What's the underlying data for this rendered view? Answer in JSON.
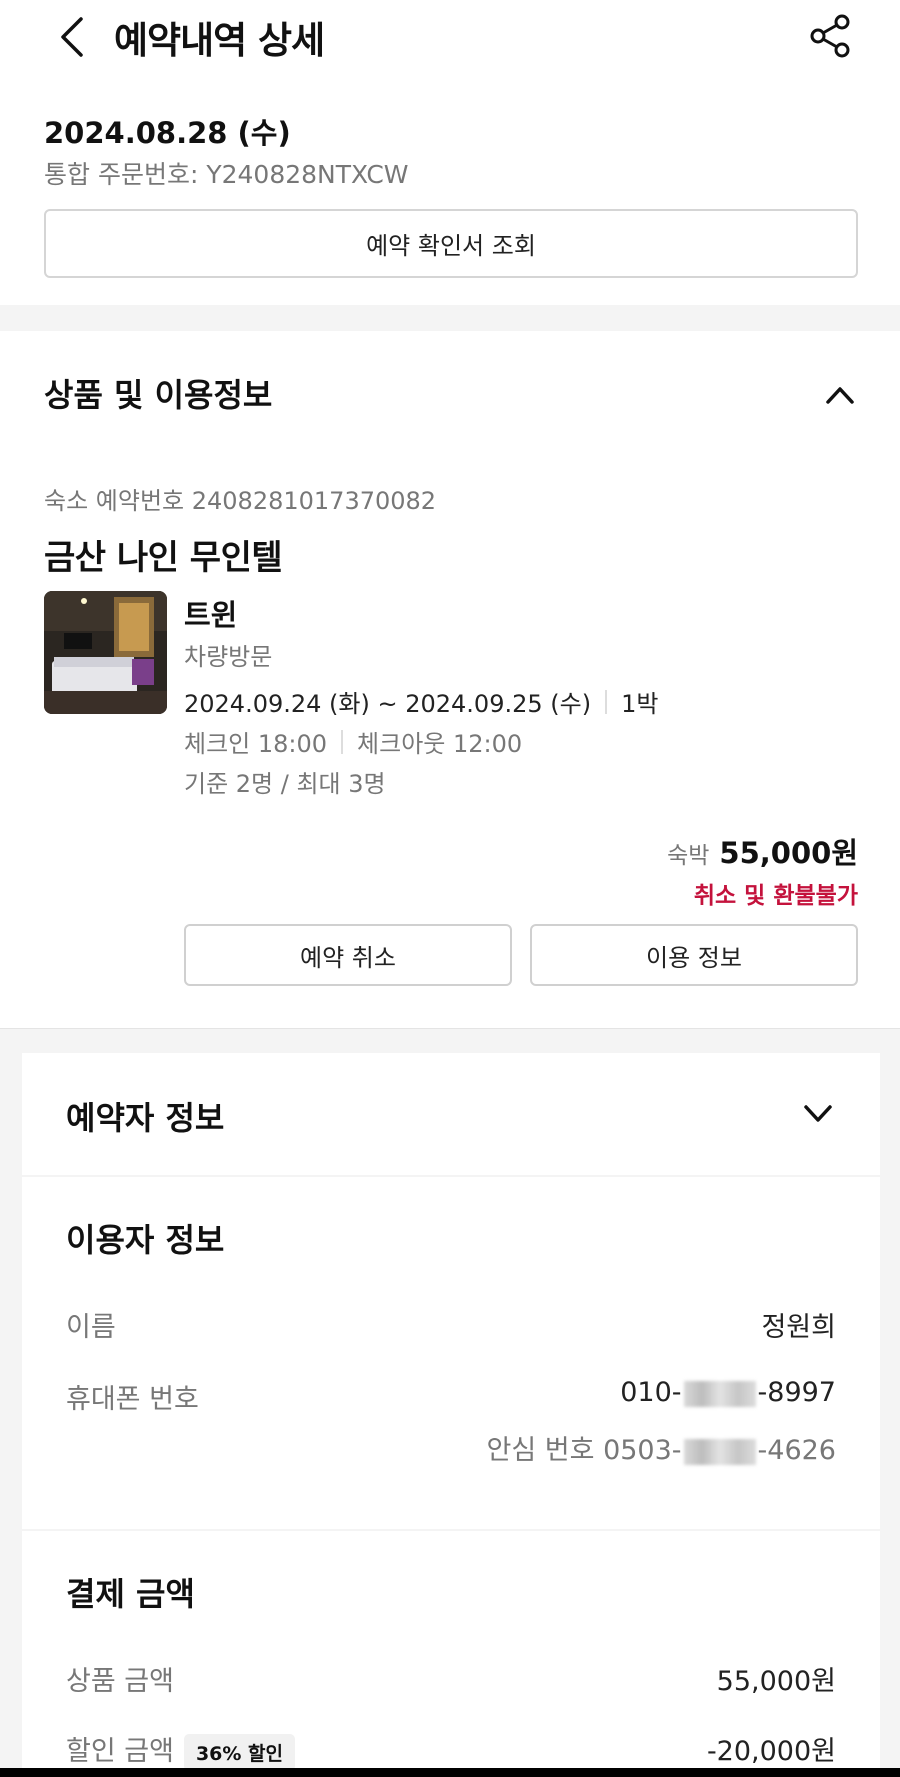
{
  "header": {
    "title": "예약내역 상세",
    "back_icon": "chevron-left-icon",
    "share_icon": "share-icon"
  },
  "order": {
    "date": "2024.08.28 (수)",
    "number_label": "통합 주문번호: ",
    "number": "Y240828NTXCW",
    "confirm_button": "예약 확인서 조회"
  },
  "product_section": {
    "title": "상품 및 이용정보",
    "toggle_icon": "chevron-up-icon",
    "reservation_label": "숙소 예약번호",
    "reservation_number": "2408281017370082",
    "hotel_name": "금산 나인 무인텔",
    "room": {
      "name": "트윈",
      "option": "차량방문",
      "dates": "2024.09.24 (화) ~ 2024.09.25 (수)",
      "nights": "1박",
      "checkin": "체크인 18:00",
      "checkout": "체크아웃 12:00",
      "occupancy": "기준 2명 / 최대 3명"
    },
    "price_label": "숙박",
    "price": "55,000원",
    "refund_notice": "취소 및 환불불가",
    "cancel_button": "예약 취소",
    "info_button": "이용 정보"
  },
  "booker_section": {
    "title": "예약자 정보",
    "toggle_icon": "chevron-down-icon"
  },
  "user_section": {
    "title": "이용자 정보",
    "name_label": "이름",
    "name_value": "정원희",
    "phone_label": "휴대폰 번호",
    "phone_prefix": "010-",
    "phone_suffix": "-8997",
    "safe_label": "안심 번호",
    "safe_prefix": "0503-",
    "safe_suffix": "-4626"
  },
  "payment_section": {
    "title": "결제 금액",
    "product_label": "상품 금액",
    "product_value": "55,000원",
    "discount_label": "할인 금액",
    "discount_badge": "36% 할인",
    "discount_value": "-20,000원"
  },
  "colors": {
    "accent_red": "#c4123c",
    "border": "#d5d5d5",
    "muted_text": "#777777",
    "background_gray": "#f4f4f4"
  }
}
